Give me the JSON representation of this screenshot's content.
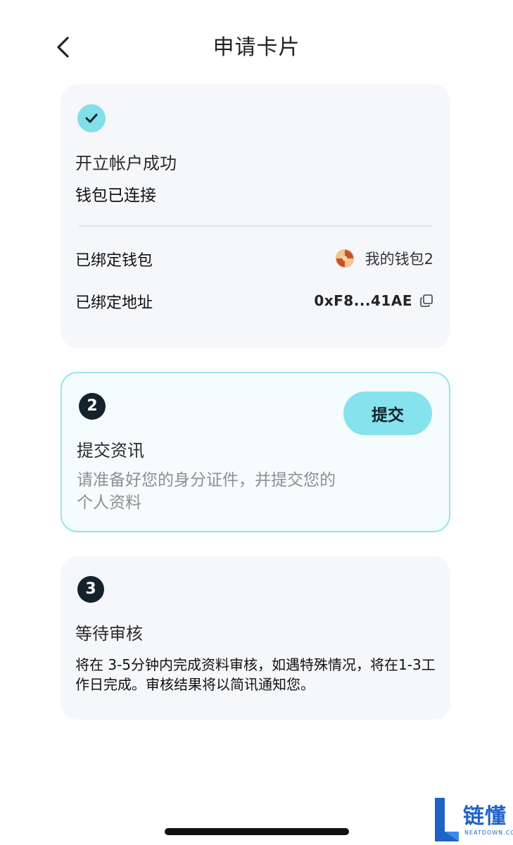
{
  "header": {
    "title": "申请卡片"
  },
  "step1": {
    "title": "开立帐户成功",
    "subtitle": "钱包已连接",
    "bound_wallet_label": "已绑定钱包",
    "bound_wallet_value": "我的钱包2",
    "bound_address_label": "已绑定地址",
    "bound_address_value": "0xF8...41AE"
  },
  "step2": {
    "number": "2",
    "title": "提交资讯",
    "button_label": "提交",
    "description": "请准备好您的身分证件，并提交您的个人资料"
  },
  "step3": {
    "number": "3",
    "title": "等待审核",
    "description": "将在 3-5分钟内完成资料审核，如遇特殊情况，将在1-3工作日完成。审核结果将以简讯通知您。"
  },
  "watermark": {
    "text": "链懂",
    "subtext": "NEATDOWN.COM"
  },
  "colors": {
    "accent": "#86e2ec",
    "step_circle": "#14222c",
    "card_bg": "#f6f7fa",
    "watermark": "#1f63c6"
  },
  "icons": [
    "chevron-left-icon",
    "check-icon",
    "wallet-avatar-icon",
    "copy-icon"
  ]
}
